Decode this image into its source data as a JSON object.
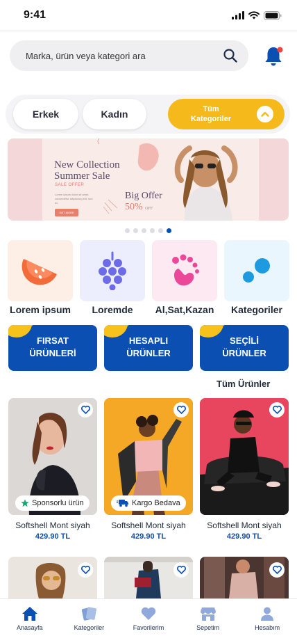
{
  "status_bar": {
    "time": "9:41"
  },
  "search": {
    "placeholder": "Marka, ürün veya kategori ara"
  },
  "tabs": {
    "men": "Erkek",
    "women": "Kadın",
    "all": "Tüm Kategoriler"
  },
  "banner": {
    "title": "New Collection Summer Sale",
    "subtitle": "SALE OFFER",
    "body": "Lorem ipsum dolor sit amet, consectetur adipiscing elit, sed do",
    "button": "GET MORE",
    "offer_line1": "Big Offer",
    "offer_pct": "50%",
    "offer_off": "OFF"
  },
  "carousel": {
    "count": 6,
    "active_index": 5
  },
  "quick_categories": [
    {
      "label": "Lorem ipsum",
      "icon": "watermelon-icon"
    },
    {
      "label": "Loremde",
      "icon": "grapes-icon"
    },
    {
      "label": "Al,Sat,Kazan",
      "icon": "footprint-icon"
    },
    {
      "label": "Kategoriler",
      "icon": "bubbles-icon"
    }
  ],
  "promos": [
    {
      "line1": "FIRSAT",
      "line2": "ÜRÜNLERİ"
    },
    {
      "line1": "HESAPLI",
      "line2": "ÜRÜNLER"
    },
    {
      "line1": "SEÇİLİ",
      "line2": "ÜRÜNLER"
    }
  ],
  "all_products_label": "Tüm Ürünler",
  "products": [
    {
      "name": "Softshell Mont siyah",
      "price": "429.90 TL",
      "badge": "Sponsorlu ürün",
      "badge_icon": "star-icon"
    },
    {
      "name": "Softshell Mont siyah",
      "price": "429.90 TL",
      "badge": "Kargo Bedava",
      "badge_icon": "truck-icon"
    },
    {
      "name": "Softshell Mont siyah",
      "price": "429.90 TL",
      "badge": "",
      "badge_icon": ""
    }
  ],
  "bottom_nav": [
    {
      "label": "Anasayfa",
      "icon": "home-icon",
      "active": true
    },
    {
      "label": "Kategoriler",
      "icon": "categories-icon",
      "active": false
    },
    {
      "label": "Favorilerim",
      "icon": "heart-icon",
      "active": false
    },
    {
      "label": "Sepetim",
      "icon": "store-icon",
      "active": false
    },
    {
      "label": "Hesabım",
      "icon": "user-icon",
      "active": false
    }
  ],
  "colors": {
    "primary": "#0b4fb3",
    "accent": "#f6b91b",
    "notification": "#ef4444"
  }
}
